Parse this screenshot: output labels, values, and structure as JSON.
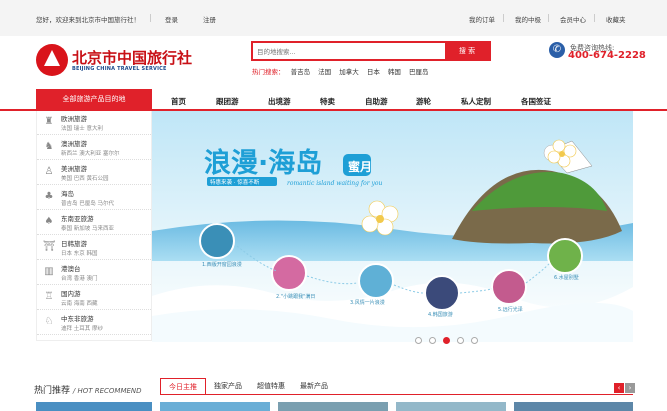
{
  "topbar": {
    "welcome": "您好，欢迎来到北京市中国旅行社！",
    "login": "登录",
    "register": "注册",
    "my_orders": "我的订单",
    "my_center": "我的中极",
    "member_center": "会员中心",
    "favorites": "收藏夹"
  },
  "logo": {
    "cn": "北京市中国旅行社",
    "en": "BEIJING CHINA TRAVEL SERVICE"
  },
  "search": {
    "placeholder": "目的地搜索...",
    "button": "搜 索",
    "hot_label": "热门搜索：",
    "hot_words": [
      "普吉岛",
      "法国",
      "加拿大",
      "日本",
      "韩国",
      "巴厘岛"
    ]
  },
  "phone": {
    "label": "免费咨询热线:",
    "number": "400-674-2228"
  },
  "nav": {
    "all_products": "全部旅游产品目的地",
    "items": [
      "首页",
      "跟团游",
      "出境游",
      "特卖",
      "自助游",
      "游轮",
      "私人定制",
      "各国签证"
    ]
  },
  "sidebar": [
    {
      "title": "欧洲旅游",
      "subs": [
        "法国",
        "瑞士",
        "意大利"
      ],
      "icon": "eiffel-tower-icon"
    },
    {
      "title": "澳洲旅游",
      "subs": [
        "新西兰",
        "澳大利亚",
        "塞尔尔"
      ],
      "icon": "kangaroo-icon"
    },
    {
      "title": "美洲旅游",
      "subs": [
        "美国",
        "巴西",
        "黄石公园"
      ],
      "icon": "statue-of-liberty-icon"
    },
    {
      "title": "海岛",
      "subs": [
        "普吉岛",
        "巴厘岛",
        "马尔代"
      ],
      "icon": "island-icon"
    },
    {
      "title": "东南亚旅游",
      "subs": [
        "泰国",
        "新加坡",
        "马来西亚"
      ],
      "icon": "pagoda-icon"
    },
    {
      "title": "日韩旅游",
      "subs": [
        "日本",
        "东京",
        "韩国"
      ],
      "icon": "torii-icon"
    },
    {
      "title": "港澳台",
      "subs": [
        "台湾",
        "香港",
        "澳门"
      ],
      "icon": "city-icon"
    },
    {
      "title": "国内游",
      "subs": [
        "云南",
        "海南",
        "西藏"
      ],
      "icon": "great-wall-icon"
    },
    {
      "title": "中东非旅游",
      "subs": [
        "迪拜",
        "土耳其",
        "摩纱"
      ],
      "icon": "camel-icon"
    }
  ],
  "banner": {
    "headline": "浪漫·海岛",
    "badge": "蜜月",
    "tag": "特惠来袭 · 惊喜不断",
    "script": "romantic island waiting for you",
    "labels": [
      "1.西版开窗园浪漫",
      "2.\"小跳跟我\"满日",
      "3.风情一片浪漫",
      "4.韩国旅游",
      "5.远行光泽",
      "6.水屋别墅"
    ],
    "slide_count": 5,
    "active_slide": 4
  },
  "hot": {
    "title_cn": "热门推荐",
    "title_en": "/ HOT RECOMMEND",
    "tabs": [
      "今日主推",
      "独家产品",
      "超值特惠",
      "最新产品"
    ],
    "prev": "‹",
    "next": "›"
  },
  "colors": {
    "brand_red": "#e0212a",
    "brand_blue": "#2b5fa8"
  }
}
